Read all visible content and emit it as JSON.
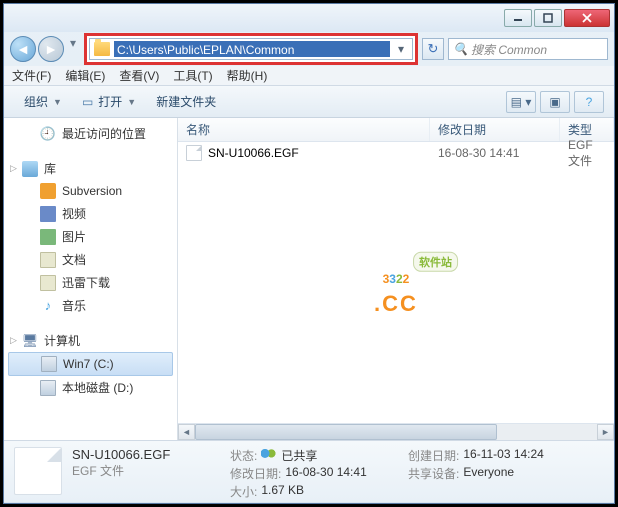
{
  "address_path": "C:\\Users\\Public\\EPLAN\\Common",
  "search_placeholder": "搜索 Common",
  "menubar": {
    "file": "文件(F)",
    "edit": "编辑(E)",
    "view": "查看(V)",
    "tools": "工具(T)",
    "help": "帮助(H)"
  },
  "toolbar": {
    "organize": "组织",
    "open": "打开",
    "new_folder": "新建文件夹"
  },
  "tree": {
    "recent": "最近访问的位置",
    "library": "库",
    "svn": "Subversion",
    "video": "视频",
    "pictures": "图片",
    "docs": "文档",
    "xunlei": "迅雷下载",
    "music": "音乐",
    "computer": "计算机",
    "c_drive": "Win7 (C:)",
    "d_drive": "本地磁盘 (D:)"
  },
  "columns": {
    "name": "名称",
    "modified": "修改日期",
    "type": "类型"
  },
  "files": [
    {
      "name": "SN-U10066.EGF",
      "modified": "16-08-30 14:41",
      "type": "EGF 文件"
    }
  ],
  "watermark": {
    "digits": "3322",
    "tag": "软件站",
    "cc": ".CC"
  },
  "details": {
    "filename": "SN-U10066.EGF",
    "filetype": "EGF 文件",
    "status_label": "状态:",
    "status_value": "已共享",
    "modified_label": "修改日期:",
    "modified_value": "16-08-30 14:41",
    "size_label": "大小:",
    "size_value": "1.67 KB",
    "created_label": "创建日期:",
    "created_value": "16-11-03 14:24",
    "shared_label": "共享设备:",
    "shared_value": "Everyone"
  }
}
